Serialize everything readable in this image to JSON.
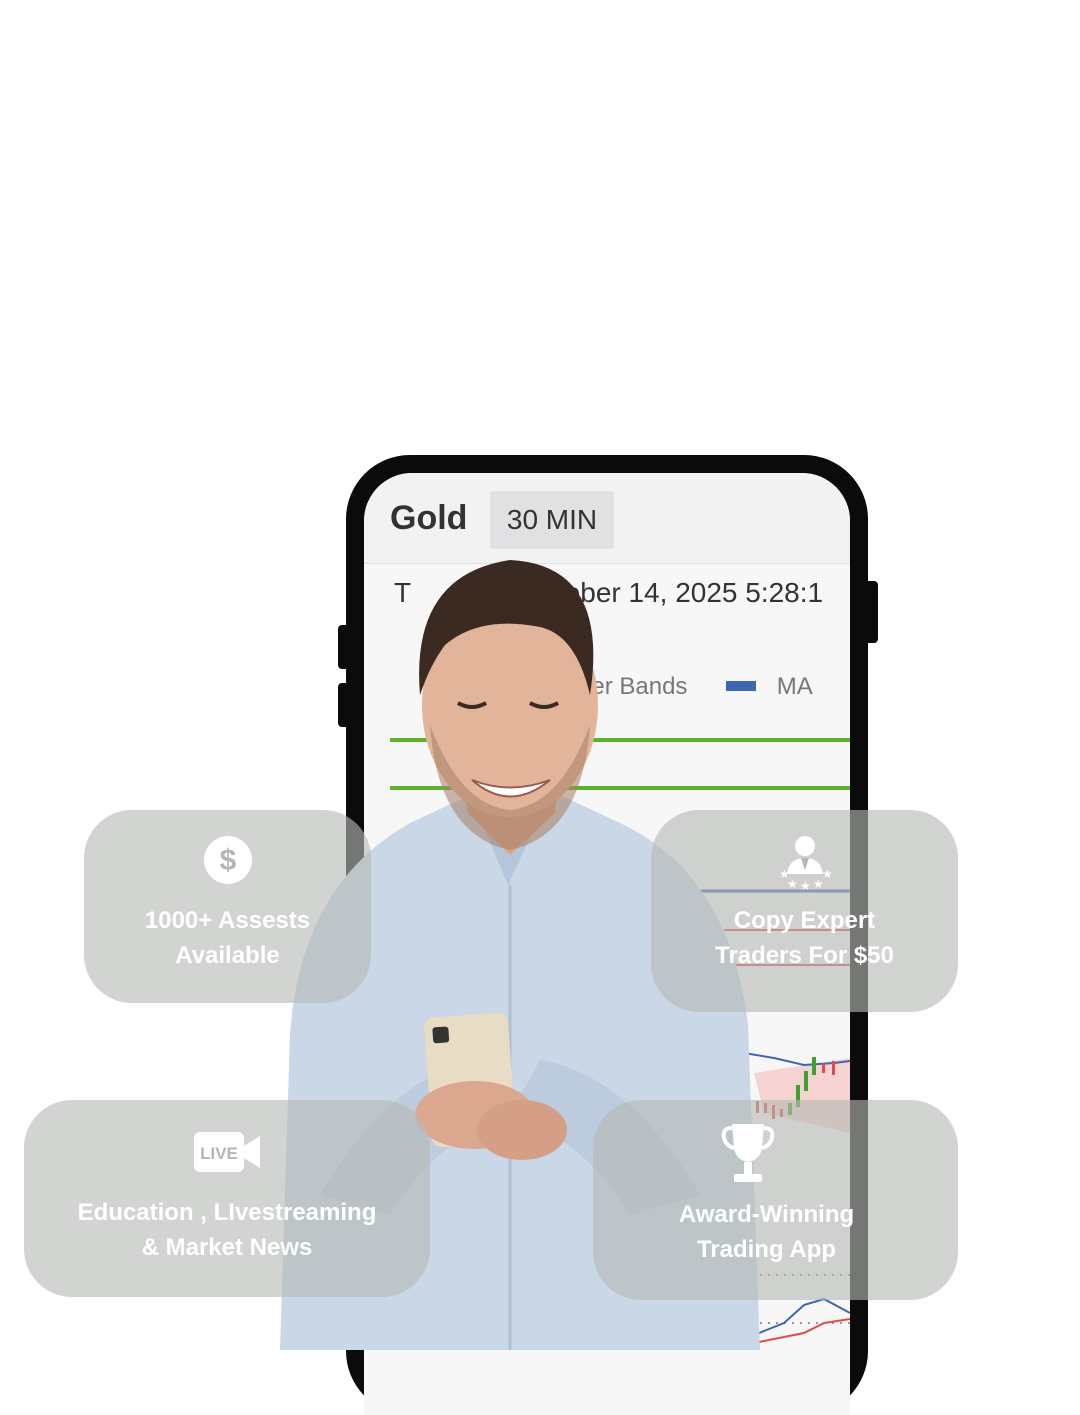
{
  "chart": {
    "asset": "Gold",
    "timeframe": "30 MIN",
    "date_visible": "October 14, 2025 5:28:1",
    "legend": [
      {
        "label": "llinger Bands",
        "color": "#e0a3a3"
      },
      {
        "label": "MA",
        "color": "#3f67b1"
      }
    ],
    "colors": {
      "band": "#5cb32d",
      "ma": "#3f67b1",
      "bearish": "#e04b4b",
      "bullish": "#3fa02d"
    }
  },
  "features": [
    {
      "icon": "dollar-icon",
      "lines": [
        "1000+ Assests",
        "Available"
      ]
    },
    {
      "icon": "expert-trader-icon",
      "lines": [
        "Copy Expert",
        "Traders For $50"
      ]
    },
    {
      "icon": "live-video-icon",
      "icon_text": "LIVE",
      "lines": [
        "Education , LIvestreaming",
        "& Market News"
      ]
    },
    {
      "icon": "trophy-icon",
      "lines": [
        "Award-Winning",
        "Trading App"
      ]
    }
  ]
}
